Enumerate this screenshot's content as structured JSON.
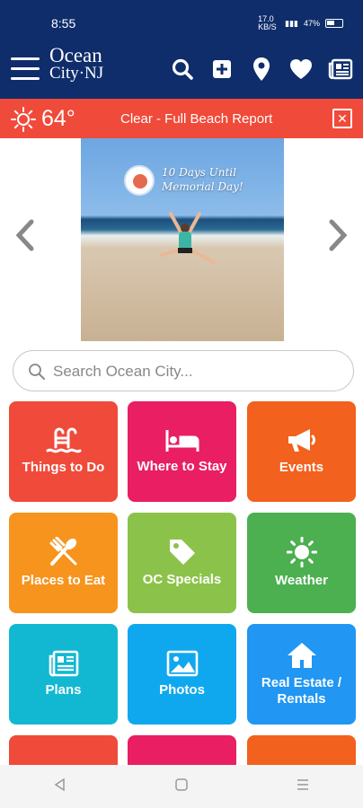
{
  "status_bar": {
    "time": "8:55",
    "net_speed": "17.0 KB/S",
    "battery": "47%"
  },
  "header": {
    "logo_line1": "Ocean",
    "logo_line2": "City·NJ"
  },
  "weather": {
    "temperature": "64°",
    "report_link": "Clear - Full Beach Report"
  },
  "carousel": {
    "caption_line1": "10 Days Until",
    "caption_line2": "Memorial Day!"
  },
  "search": {
    "placeholder": "Search Ocean City..."
  },
  "tiles": [
    {
      "label": "Things to Do",
      "color": "#f04a3a",
      "icon": "pool-icon"
    },
    {
      "label": "Where to Stay",
      "color": "#e91e63",
      "icon": "bed-icon"
    },
    {
      "label": "Events",
      "color": "#f2611d",
      "icon": "megaphone-icon"
    },
    {
      "label": "Places to Eat",
      "color": "#f7941d",
      "icon": "utensils-icon"
    },
    {
      "label": "OC Specials",
      "color": "#8bc34a",
      "icon": "tag-icon"
    },
    {
      "label": "Weather",
      "color": "#4caf50",
      "icon": "sun-icon"
    },
    {
      "label": "Plans",
      "color": "#12b8d2",
      "icon": "newspaper-icon"
    },
    {
      "label": "Photos",
      "color": "#0fa8ef",
      "icon": "image-icon"
    },
    {
      "label": "Real Estate / Rentals",
      "color": "#2196f3",
      "icon": "house-icon"
    }
  ],
  "partial_tile_colors": [
    "#f04a3a",
    "#e91e63",
    "#f2611d"
  ]
}
